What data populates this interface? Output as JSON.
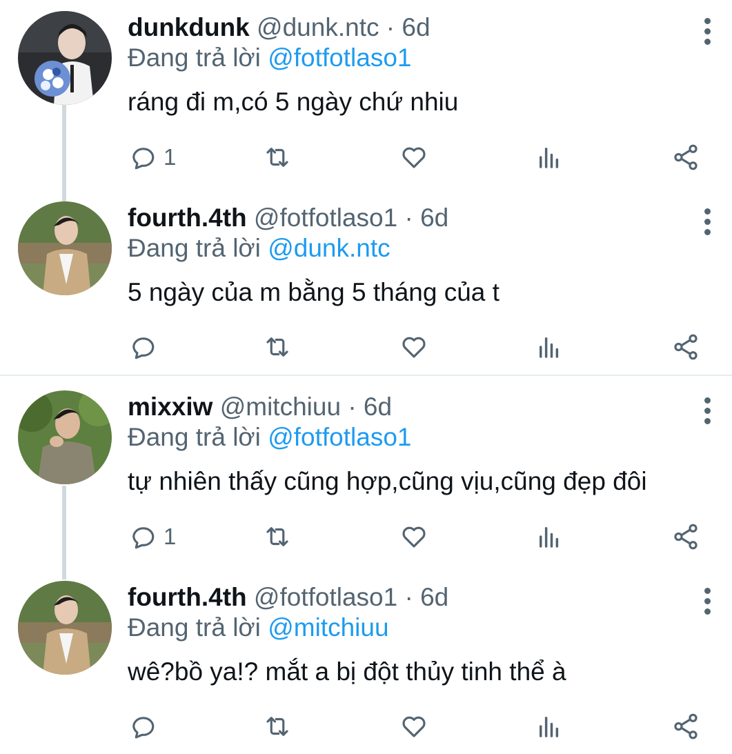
{
  "tweets": [
    {
      "display_name": "dunkdunk",
      "handle": "@dunk.ntc",
      "sep": "·",
      "time": "6d",
      "reply_prefix": "Đang trả lời",
      "reply_to": "@fotfotlaso1",
      "text": "ráng đi m,có 5 ngày chứ nhiu",
      "reply_count": "1",
      "avatar": "avatar-dunkdunk"
    },
    {
      "display_name": "fourth.4th",
      "handle": "@fotfotlaso1",
      "sep": "·",
      "time": "6d",
      "reply_prefix": "Đang trả lời",
      "reply_to": "@dunk.ntc",
      "text": "5 ngày của m bằng 5 tháng của t",
      "reply_count": "",
      "avatar": "avatar-fourth"
    },
    {
      "display_name": "mixxiw",
      "handle": "@mitchiuu",
      "sep": "·",
      "time": "6d",
      "reply_prefix": "Đang trả lời",
      "reply_to": "@fotfotlaso1",
      "text": "tự nhiên thấy cũng hợp,cũng vịu,cũng đẹp đôi",
      "reply_count": "1",
      "avatar": "avatar-mixxiw"
    },
    {
      "display_name": "fourth.4th",
      "handle": "@fotfotlaso1",
      "sep": "·",
      "time": "6d",
      "reply_prefix": "Đang trả lời",
      "reply_to": "@mitchiuu",
      "text": "wê?bồ ya!? mắt a bị đột thủy tinh thể à",
      "reply_count": "",
      "avatar": "avatar-fourth"
    }
  ],
  "icons": {
    "reply": "reply-icon",
    "retweet": "retweet-icon",
    "like": "heart-icon",
    "views": "analytics-icon",
    "share": "share-icon",
    "more": "more-icon"
  },
  "colors": {
    "text": "#0f1419",
    "secondary": "#536471",
    "mention": "#1d9bf0",
    "thread_line": "#cfd9de"
  }
}
